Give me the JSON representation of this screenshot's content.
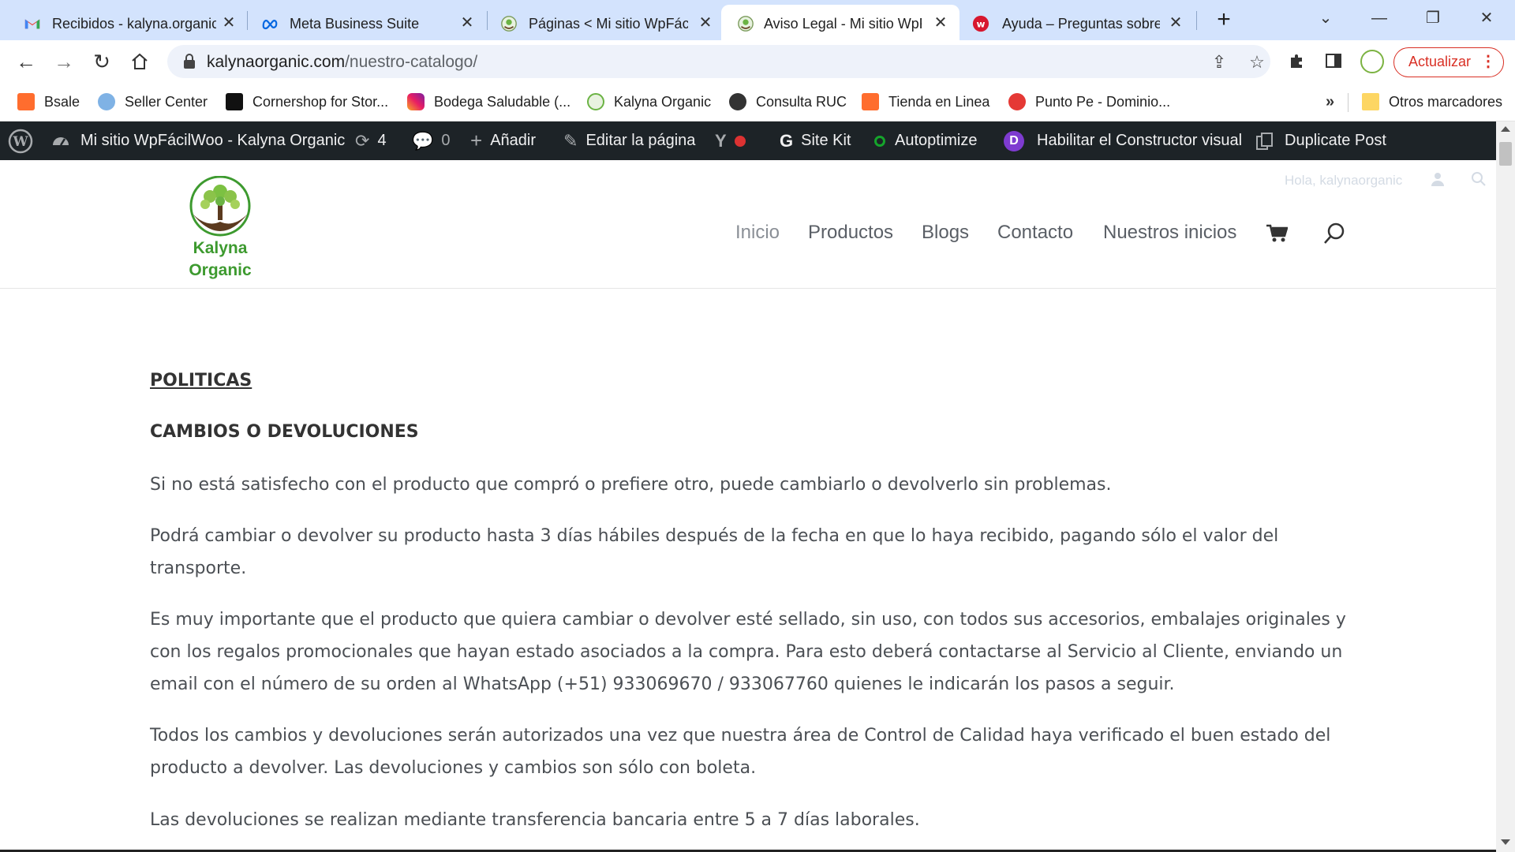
{
  "browser": {
    "tabs": [
      {
        "title": "Recibidos - kalyna.organic",
        "icon": "gmail-icon"
      },
      {
        "title": "Meta Business Suite",
        "icon": "meta-icon"
      },
      {
        "title": "Páginas < Mi sitio WpFácil",
        "icon": "site-icon"
      },
      {
        "title": "Aviso Legal - Mi sitio WpFácil",
        "icon": "site-icon",
        "active": true
      },
      {
        "title": "Ayuda – Preguntas sobre",
        "icon": "wong-icon"
      }
    ],
    "url_host": "kalynaorganic.com",
    "url_path": "/nuestro-catalogo/",
    "update_label": "Actualizar",
    "bookmarks": [
      "Bsale",
      "Seller Center",
      "Cornershop for Stor...",
      "Bodega Saludable (...",
      "Kalyna Organic",
      "Consulta RUC",
      "Tienda en Linea",
      "Punto Pe - Dominio..."
    ],
    "other_bookmarks": "Otros marcadores"
  },
  "wpbar": {
    "site_name": "Mi sitio WpFácilWoo - Kalyna Organic",
    "updates": "4",
    "comments": "0",
    "add": "Añadir",
    "edit_page": "Editar la página",
    "site_kit": "Site Kit",
    "autoptimize": "Autoptimize",
    "visual_builder": "Habilitar el Constructor visual",
    "duplicate_post": "Duplicate Post"
  },
  "site": {
    "logo_line1": "Kalyna",
    "logo_line2": "Organic",
    "greeting": "Hola, kalynaorganic",
    "menu": [
      "Inicio",
      "Productos",
      "Blogs",
      "Contacto",
      "Nuestros inicios"
    ]
  },
  "content": {
    "heading": "POLITICAS",
    "subheading": "CAMBIOS O DEVOLUCIONES",
    "paragraphs": [
      "Si no está satisfecho con el producto que compró o prefiere otro, puede cambiarlo o devolverlo sin problemas.",
      "Podrá cambiar o devolver su producto hasta 3 días hábiles después de la fecha en que lo haya recibido, pagando sólo el valor del transporte.",
      "Es muy importante que el producto que quiera cambiar o devolver esté sellado, sin uso, con todos sus accesorios, embalajes originales y con los regalos promocionales que hayan estado asociados a la compra. Para esto deberá contactarse al Servicio al Cliente, enviando un email con el número de su orden al WhatsApp (+51) 933069670 / 933067760 quienes le indicarán los pasos a seguir.",
      "Todos los cambios y devoluciones serán autorizados una vez que nuestra área de Control de Calidad haya verificado el buen estado del producto a devolver. Las devoluciones y cambios son sólo con boleta.",
      "Las devoluciones se realizan mediante transferencia bancaria entre 5 a 7 días laborales."
    ]
  },
  "colors": {
    "tabstrip": "#d3e3fd",
    "wpbar": "#1d2327",
    "logo_green": "#3d9a2f",
    "update_red": "#d93025"
  }
}
